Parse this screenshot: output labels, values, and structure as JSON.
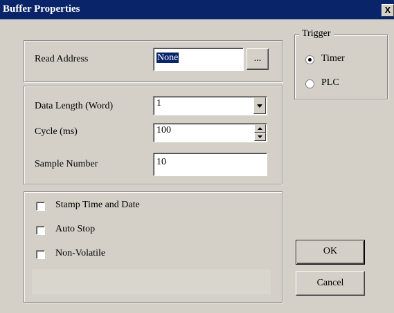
{
  "window": {
    "title": "Buffer Properties",
    "close_glyph": "X"
  },
  "read_address": {
    "label": "Read Address",
    "value": "None",
    "browse_label": "..."
  },
  "data_length": {
    "label": "Data Length (Word)",
    "value": "1"
  },
  "cycle": {
    "label": "Cycle (ms)",
    "value": "100"
  },
  "sample_number": {
    "label": "Sample Number",
    "value": "10"
  },
  "options": [
    {
      "label": "Stamp Time and Date",
      "checked": false
    },
    {
      "label": "Auto Stop",
      "checked": false
    },
    {
      "label": "Non-Volatile",
      "checked": false
    }
  ],
  "trigger": {
    "title": "Trigger",
    "options": [
      {
        "label": "Timer",
        "selected": true
      },
      {
        "label": "PLC",
        "selected": false
      }
    ]
  },
  "buttons": {
    "ok": "OK",
    "cancel": "Cancel"
  },
  "colors": {
    "titlebar": "#0a246a",
    "face": "#d4d0c8",
    "field": "#ffffff"
  }
}
